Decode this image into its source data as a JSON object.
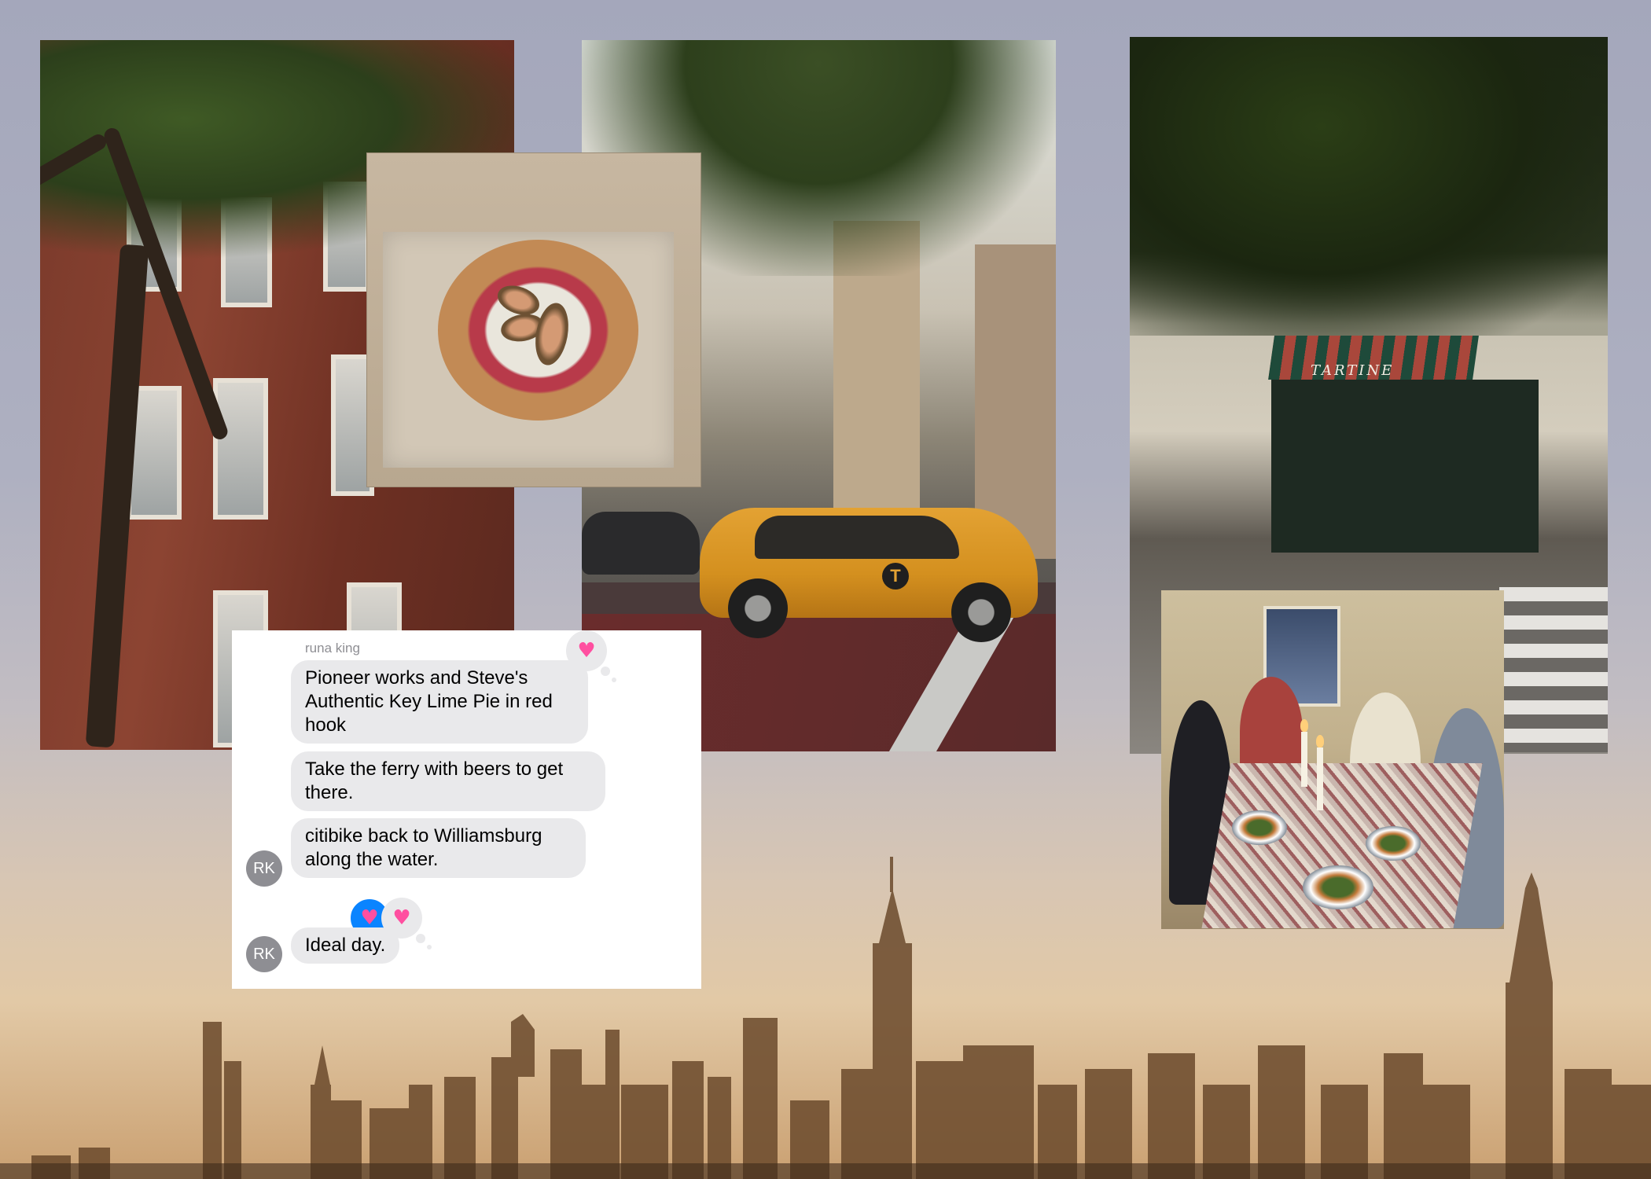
{
  "messages": {
    "sender_name": "runa king",
    "avatar_initials": "RK",
    "items": [
      {
        "text": "Pioneer works and Steve's Authentic Key Lime Pie in red hook"
      },
      {
        "text": "Take the ferry with beers to get there."
      },
      {
        "text": "citibike back to Williamsburg along the water."
      },
      {
        "text": "Ideal day."
      }
    ],
    "reactions": [
      "heart",
      "heart",
      "heart"
    ]
  },
  "photos": {
    "tartine_sign": "TARTINE"
  },
  "colors": {
    "bubble": "#e9e9eb",
    "avatar": "#8e8e93",
    "tapback_blue": "#0a84ff",
    "heart": "#ff4fa0"
  }
}
